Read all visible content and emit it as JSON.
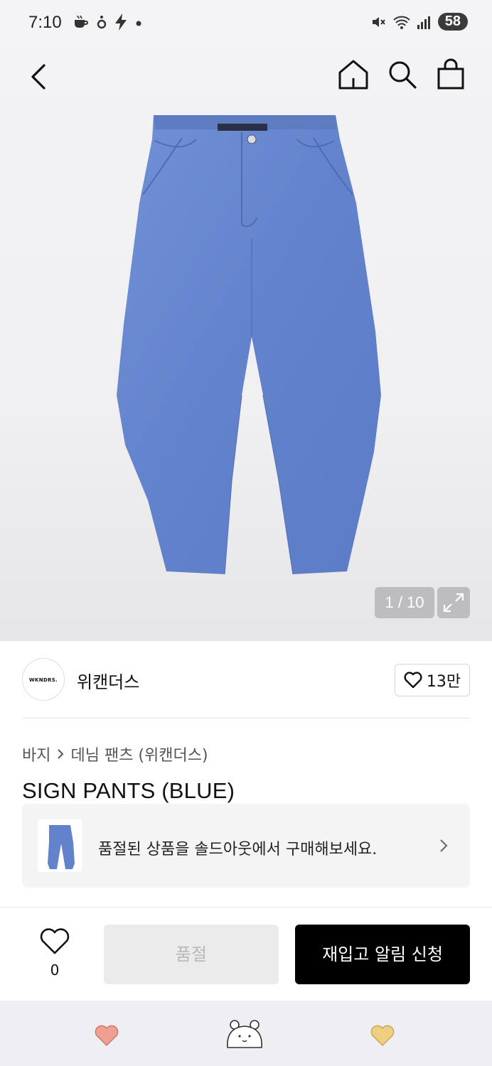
{
  "status_bar": {
    "time": "7:10",
    "battery": "58",
    "icons": [
      "coffee-icon",
      "dot-app-icon",
      "bolt-icon",
      "dot-icon",
      "mute-icon",
      "wifi-icon",
      "signal-icon"
    ]
  },
  "top_nav": {
    "icons": [
      "back-icon",
      "home-icon",
      "search-icon",
      "shopping-bag-icon"
    ]
  },
  "gallery": {
    "counter": "1 / 10",
    "product_color": "#6a88cf"
  },
  "brand": {
    "logo_text": "WKNDRS.",
    "name": "위캔더스",
    "likes": "13만"
  },
  "breadcrumb": {
    "category": "바지",
    "subcategory": "데님 팬츠 (위캔더스)"
  },
  "product": {
    "title": "SIGN PANTS (BLUE)"
  },
  "soldout_banner": {
    "text": "품절된 상품을 솔드아웃에서 구매해보세요."
  },
  "action_bar": {
    "wish_count": "0",
    "soldout_label": "품절",
    "restock_label": "재입고 알림 신청"
  },
  "colors": {
    "accent_black": "#000000",
    "dock_left_heart": "#f0a090",
    "dock_right_heart": "#f0cf80"
  }
}
